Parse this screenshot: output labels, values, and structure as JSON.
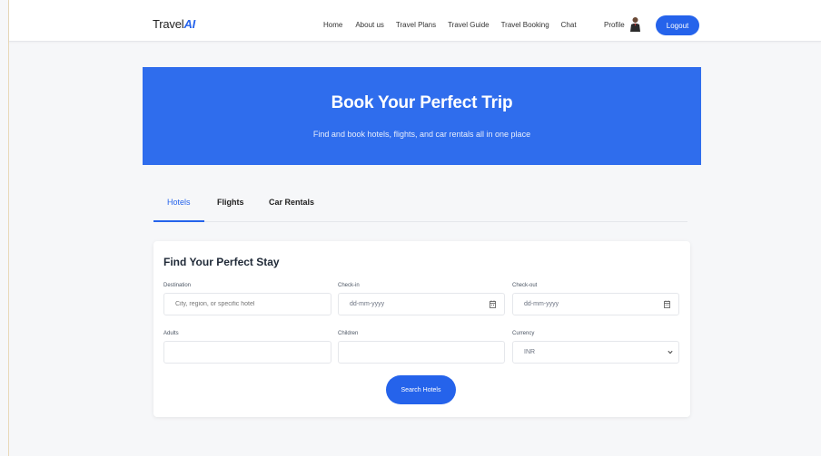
{
  "navbar": {
    "brand_prefix": "Travel",
    "brand_suffix": "AI",
    "links": [
      "Home",
      "About us",
      "Travel Plans",
      "Travel Guide",
      "Travel Booking",
      "Chat"
    ],
    "profile_label": "Profile",
    "logout_label": "Logout"
  },
  "hero": {
    "title": "Book Your Perfect Trip",
    "subtitle": "Find and book hotels, flights, and car rentals all in one place"
  },
  "tabs": [
    {
      "label": "Hotels",
      "active": true
    },
    {
      "label": "Flights",
      "active": false
    },
    {
      "label": "Car Rentals",
      "active": false
    }
  ],
  "form": {
    "title": "Find Your Perfect Stay",
    "destination": {
      "label": "Destination",
      "placeholder": "City, region, or specific hotel"
    },
    "checkin": {
      "label": "Check-in",
      "value": "dd-mm-yyyy",
      "icon": "calendar-icon"
    },
    "checkout": {
      "label": "Check-out",
      "value": "dd-mm-yyyy",
      "icon": "calendar-icon"
    },
    "adults": {
      "label": "Adults",
      "value": ""
    },
    "children": {
      "label": "Children",
      "value": ""
    },
    "currency": {
      "label": "Currency",
      "value": "INR",
      "icon": "chevron-down-icon"
    },
    "search_label": "Search Hotels"
  },
  "colors": {
    "accent": "#2563eb",
    "hero_bg": "#2f6ded",
    "page_bg": "#f6f7f9"
  }
}
